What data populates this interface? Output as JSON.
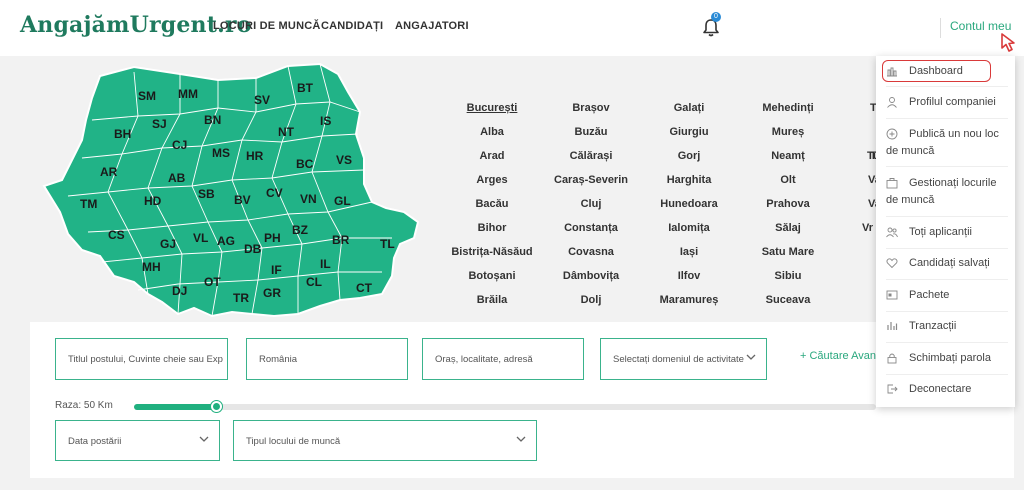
{
  "brand": {
    "logo_text": "AngajămUrgent.ro",
    "accent_color": "#2aa87e",
    "map_color": "#21b387"
  },
  "nav": {
    "items": [
      "LOCURI DE MUNCĂ",
      "CANDIDAȚI",
      "ANGAJATORI"
    ]
  },
  "notifications": {
    "count": "0"
  },
  "account": {
    "label": "Contul meu"
  },
  "map": {
    "regions": [
      "SM",
      "MM",
      "BT",
      "SV",
      "BH",
      "SJ",
      "BN",
      "IS",
      "NT",
      "CJ",
      "MS",
      "HR",
      "VS",
      "AR",
      "AB",
      "BC",
      "TM",
      "HD",
      "SB",
      "CV",
      "BV",
      "VN",
      "GL",
      "CS",
      "GJ",
      "VL",
      "AG",
      "DB",
      "PH",
      "BZ",
      "BR",
      "TL",
      "MH",
      "IF",
      "IL",
      "OT",
      "DJ",
      "TR",
      "GR",
      "CL",
      "CT"
    ]
  },
  "cities": {
    "columns": [
      [
        "București",
        "Alba",
        "Arad",
        "Arges",
        "Bacău",
        "Bihor",
        "Bistrița-Năsăud",
        "Botoșani",
        "Brăila"
      ],
      [
        "Brașov",
        "Buzău",
        "Călărași",
        "Caraș-Severin",
        "Cluj",
        "Constanța",
        "Covasna",
        "Dâmbovița",
        "Dolj"
      ],
      [
        "Galați",
        "Giurgiu",
        "Gorj",
        "Harghita",
        "Hunedoara",
        "Ialomița",
        "Iași",
        "Ilfov",
        "Maramureș"
      ],
      [
        "Mehedinți",
        "Mureș",
        "Neamț",
        "Olt",
        "Prahova",
        "Sălaj",
        "Satu Mare",
        "Sibiu",
        "Suceava"
      ],
      [
        "Tele",
        "Ti",
        "Tu",
        "Va",
        "Va",
        "Vr"
      ]
    ],
    "active": "București"
  },
  "search": {
    "keyword_placeholder": "Titlul postului, Cuvinte cheie sau Exp",
    "country_value": "România",
    "location_placeholder": "Oraș, localitate, adresă",
    "domain_placeholder": "Selectați domeniul de activitate",
    "advanced_label": "+ Căutare Avan",
    "range_label": "Raza: 50 Km",
    "range_fraction": 0.11,
    "date_placeholder": "Data postării",
    "job_type_placeholder": "Tipul locului de muncă"
  },
  "account_menu": {
    "items": [
      {
        "label": "Dashboard",
        "icon": "dashboard-icon"
      },
      {
        "label": "Profilul companiei",
        "icon": "user-icon"
      },
      {
        "label": "Publică un nou loc de muncă",
        "icon": "plus-circle-icon"
      },
      {
        "label": "Gestionați locurile de muncă",
        "icon": "briefcase-icon"
      },
      {
        "label": "Toți aplicanții",
        "icon": "users-icon"
      },
      {
        "label": "Candidați salvați",
        "icon": "heart-icon"
      },
      {
        "label": "Pachete",
        "icon": "package-icon"
      },
      {
        "label": "Tranzacții",
        "icon": "transactions-icon"
      },
      {
        "label": "Schimbați parola",
        "icon": "password-icon"
      },
      {
        "label": "Deconectare",
        "icon": "logout-icon"
      }
    ]
  }
}
